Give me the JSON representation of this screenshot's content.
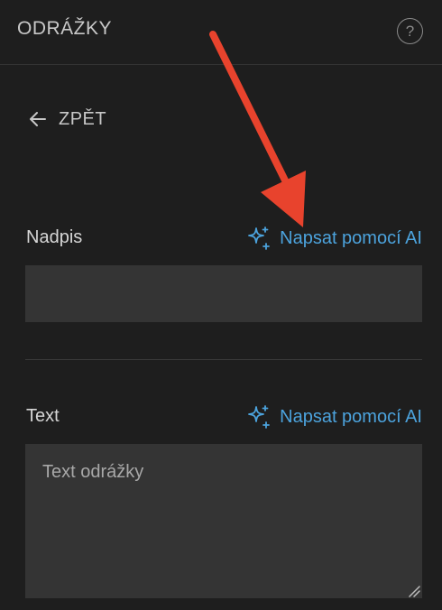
{
  "header": {
    "title": "ODRÁŽKY",
    "help_glyph": "?",
    "help_icon": "question-circle-icon"
  },
  "back": {
    "label": "ZPĚT",
    "icon": "arrow-left-icon"
  },
  "fields": {
    "heading": {
      "label": "Nadpis",
      "ai_label": "Napsat pomocí AI",
      "value": "",
      "placeholder": ""
    },
    "text": {
      "label": "Text",
      "ai_label": "Napsat pomocí AI",
      "value": "",
      "placeholder": "Text odrážky"
    }
  },
  "colors": {
    "background": "#1e1e1e",
    "input_background": "#343434",
    "accent": "#4ca3dd",
    "annotation_arrow": "#e8432d"
  }
}
